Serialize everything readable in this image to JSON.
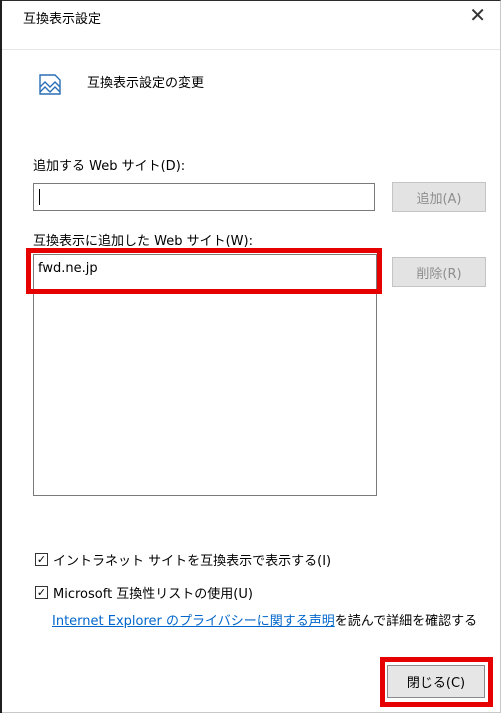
{
  "window": {
    "title": "互換表示設定"
  },
  "header": {
    "text": "互換表示設定の変更"
  },
  "add_site": {
    "label": "追加する Web サイト(D):",
    "value": "",
    "button_label": "追加(A)"
  },
  "sites": {
    "label": "互換表示に追加した Web サイト(W):",
    "items": [
      "fwd.ne.jp"
    ],
    "remove_button_label": "削除(R)"
  },
  "options": {
    "intranet_label": "イントラネット サイトを互換表示で表示する(I)",
    "intranet_checked": true,
    "microsoft_list_label": "Microsoft 互換性リストの使用(U)",
    "microsoft_list_checked": true
  },
  "privacy": {
    "link_text": "Internet Explorer のプライバシーに関する声明",
    "suffix_text": "を読んで詳細を確認する"
  },
  "footer": {
    "close_label": "閉じる(C)"
  },
  "colors": {
    "highlight": "#e60000",
    "link": "#0066cc"
  }
}
